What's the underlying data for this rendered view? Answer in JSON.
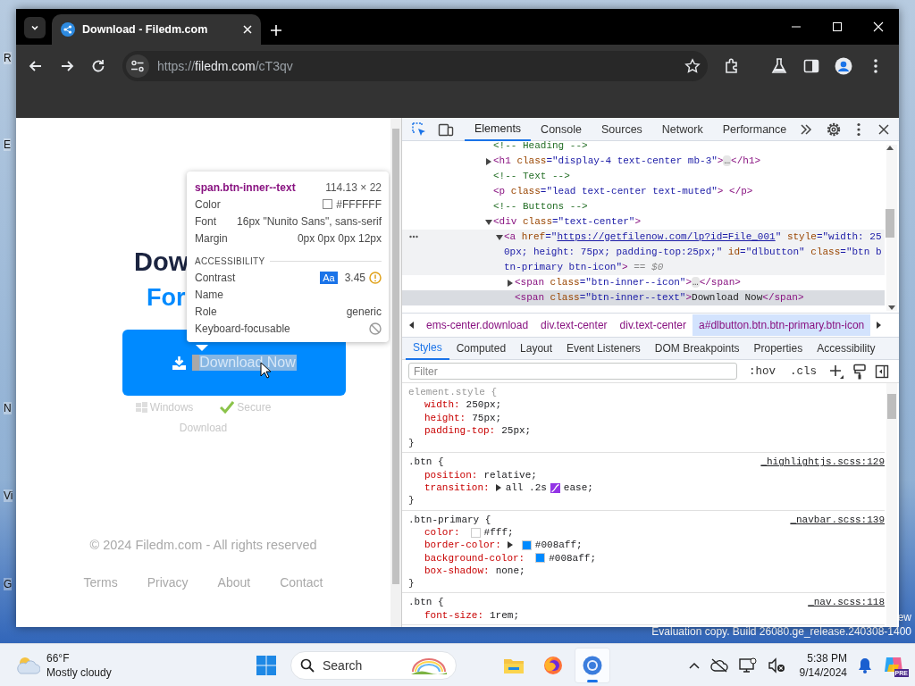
{
  "desktop": {
    "icon_labels": [
      "R",
      "E",
      "N",
      "Vi",
      "G"
    ],
    "notice_lines": [
      "ew",
      "Evaluation copy. Build 26080.ge_release.240308-1400"
    ]
  },
  "browser": {
    "tab": {
      "title": "Download - Filedm.com",
      "selected": true
    },
    "url": {
      "scheme": "https://",
      "host": "filedm.com",
      "path": "/cT3qv"
    }
  },
  "page": {
    "heading": [
      "Dow",
      "For"
    ],
    "button": {
      "label": "Download Now",
      "inspected": true
    },
    "features": [
      {
        "kind": "os",
        "label": "Windows"
      },
      {
        "kind": "check",
        "label": "Secure"
      }
    ],
    "caption": "Download",
    "copyright": "© 2024 Filedm.com - All rights reserved",
    "links": [
      "Terms",
      "Privacy",
      "About",
      "Contact"
    ]
  },
  "tooltip": {
    "selector": "span.btn-inner--text",
    "size": "114.13 × 22",
    "rows": [
      {
        "label": "Color",
        "value": "#FFFFFF",
        "color": "#ffffff"
      },
      {
        "label": "Font",
        "value": "16px \"Nunito Sans\", sans-serif"
      },
      {
        "label": "Margin",
        "value": "0px 0px 0px 12px"
      }
    ],
    "section": "ACCESSIBILITY",
    "a11y": [
      {
        "label": "Contrast",
        "kind": "contrast",
        "badge": "Aa",
        "value": "3.45"
      },
      {
        "label": "Name",
        "kind": "text"
      },
      {
        "label": "Role",
        "kind": "text",
        "value": "generic"
      },
      {
        "label": "Keyboard-focusable",
        "kind": "blocked"
      }
    ]
  },
  "devtools": {
    "tabs": [
      {
        "label": "Elements",
        "selected": true
      },
      {
        "label": "Console",
        "selected": false
      },
      {
        "label": "Sources",
        "selected": false
      },
      {
        "label": "Network",
        "selected": false
      },
      {
        "label": "Performance",
        "selected": false
      }
    ],
    "dom": [
      {
        "selected": false,
        "hovered": false,
        "parts": [
          {
            "kind": "comment",
            "text": "<!-- Heading -->"
          }
        ]
      },
      {
        "selected": false,
        "hovered": false,
        "expanded": false,
        "parts": [
          {
            "kind": "tag",
            "text": "<h1"
          },
          {
            "kind": "attr",
            "text": " class"
          },
          {
            "kind": "value",
            "text": "=\"display-4 text-center mb-3\""
          },
          {
            "kind": "tag",
            "text": ">"
          },
          {
            "kind": "ellipsis",
            "text": "…"
          },
          {
            "kind": "tag",
            "text": "</h1>"
          }
        ]
      },
      {
        "selected": false,
        "hovered": false,
        "parts": [
          {
            "kind": "comment",
            "text": "<!-- Text -->"
          }
        ]
      },
      {
        "selected": false,
        "hovered": false,
        "parts": [
          {
            "kind": "tag",
            "text": "<p"
          },
          {
            "kind": "attr",
            "text": " class"
          },
          {
            "kind": "value",
            "text": "=\"lead text-center text-muted\""
          },
          {
            "kind": "tag",
            "text": "> </p>"
          }
        ]
      },
      {
        "selected": false,
        "hovered": false,
        "parts": [
          {
            "kind": "comment",
            "text": "<!-- Buttons -->"
          }
        ]
      },
      {
        "selected": false,
        "hovered": false,
        "expanded": true,
        "parts": [
          {
            "kind": "tag",
            "text": "<div"
          },
          {
            "kind": "attr",
            "text": " class"
          },
          {
            "kind": "value",
            "text": "=\"text-center\""
          },
          {
            "kind": "tag",
            "text": ">"
          }
        ],
        "children": [
          {
            "selected": true,
            "hovered": false,
            "expanded": true,
            "parts": [
              {
                "kind": "tag",
                "text": "<a"
              },
              {
                "kind": "attr",
                "text": " href"
              },
              {
                "kind": "value",
                "text": "=\""
              },
              {
                "kind": "link",
                "text": "https://getfilenow.com/lp?id=File_001"
              },
              {
                "kind": "value",
                "text": "\""
              },
              {
                "kind": "attr",
                "text": " style"
              },
              {
                "kind": "value",
                "text": "=\"width: 250px; height: 75px; padding-top:25px;\""
              },
              {
                "kind": "attr",
                "text": " id"
              },
              {
                "kind": "value",
                "text": "=\"dlbutton\""
              },
              {
                "kind": "attr",
                "text": " class"
              },
              {
                "kind": "value",
                "text": "=\"btn btn-primary btn-icon\""
              },
              {
                "kind": "tag",
                "text": ">"
              },
              {
                "kind": "ref",
                "text": " == $0"
              }
            ],
            "children": [
              {
                "selected": false,
                "hovered": false,
                "expanded": false,
                "parts": [
                  {
                    "kind": "tag",
                    "text": "<span"
                  },
                  {
                    "kind": "attr",
                    "text": " class"
                  },
                  {
                    "kind": "value",
                    "text": "=\"btn-inner--icon\""
                  },
                  {
                    "kind": "tag",
                    "text": ">"
                  },
                  {
                    "kind": "ellipsis",
                    "text": "…"
                  },
                  {
                    "kind": "tag",
                    "text": "</span>"
                  }
                ]
              },
              {
                "selected": false,
                "hovered": true,
                "parts": [
                  {
                    "kind": "tag",
                    "text": "<span"
                  },
                  {
                    "kind": "attr",
                    "text": " class"
                  },
                  {
                    "kind": "value",
                    "text": "=\"btn-inner--text\""
                  },
                  {
                    "kind": "tag",
                    "text": ">"
                  },
                  {
                    "kind": "text",
                    "text": "Download Now"
                  },
                  {
                    "kind": "tag",
                    "text": "</span>"
                  }
                ]
              }
            ]
          }
        ]
      }
    ],
    "breadcrumbs": [
      {
        "label": "ems-center.download",
        "selected": false
      },
      {
        "label": "div.text-center",
        "selected": false
      },
      {
        "label": "div.text-center",
        "selected": false
      },
      {
        "label": "a#dlbutton.btn.btn-primary.btn-icon",
        "selected": true
      }
    ],
    "style_tabs": [
      {
        "label": "Styles",
        "selected": true
      },
      {
        "label": "Computed",
        "selected": false
      },
      {
        "label": "Layout",
        "selected": false
      },
      {
        "label": "Event Listeners",
        "selected": false
      },
      {
        "label": "DOM Breakpoints",
        "selected": false
      },
      {
        "label": "Properties",
        "selected": false
      },
      {
        "label": "Accessibility",
        "selected": false
      }
    ],
    "filter": {
      "placeholder": "Filter"
    },
    "filter_tools": [
      ":hov",
      ".cls"
    ],
    "rules": [
      {
        "selector": "element.style {",
        "inline": true,
        "close": "}",
        "declarations": [
          {
            "property": "width:",
            "segments": [
              {
                "kind": "text",
                "text": "250px;"
              }
            ]
          },
          {
            "property": "height:",
            "segments": [
              {
                "kind": "text",
                "text": "75px;"
              }
            ]
          },
          {
            "property": "padding-top:",
            "segments": [
              {
                "kind": "text",
                "text": "25px;"
              }
            ]
          }
        ]
      },
      {
        "selector": ".btn {",
        "inline": false,
        "source": "_highlightjs.scss:129",
        "close": "}",
        "declarations": [
          {
            "property": "position:",
            "segments": [
              {
                "kind": "text",
                "text": "relative;"
              }
            ]
          },
          {
            "property": "transition:",
            "expandable": true,
            "segments": [
              {
                "kind": "text",
                "text": "all .2s"
              },
              {
                "kind": "easing"
              },
              {
                "kind": "text",
                "text": "ease;"
              }
            ]
          }
        ]
      },
      {
        "selector": ".btn-primary {",
        "inline": false,
        "source": "_navbar.scss:139",
        "close": "}",
        "declarations": [
          {
            "property": "color:",
            "segments": [
              {
                "kind": "color",
                "color": "#ffffff"
              },
              {
                "kind": "text",
                "text": "#fff;"
              }
            ]
          },
          {
            "property": "border-color:",
            "expandable": true,
            "segments": [
              {
                "kind": "color",
                "color": "#008aff"
              },
              {
                "kind": "text",
                "text": "#008aff;"
              }
            ]
          },
          {
            "property": "background-color:",
            "segments": [
              {
                "kind": "color",
                "color": "#008aff"
              },
              {
                "kind": "text",
                "text": "#008aff;"
              }
            ]
          },
          {
            "property": "box-shadow:",
            "segments": [
              {
                "kind": "text",
                "text": "none;"
              }
            ]
          }
        ]
      },
      {
        "selector": ".btn {",
        "inline": false,
        "source": "_nav.scss:118",
        "declarations": [
          {
            "property": "font-size:",
            "segments": [
              {
                "kind": "text",
                "text": "1rem;"
              }
            ]
          }
        ]
      }
    ]
  },
  "taskbar": {
    "weather": {
      "temp": "66°F",
      "condition": "Mostly cloudy"
    },
    "search": {
      "placeholder": "Search"
    },
    "apps": [
      {
        "kind": "explorer",
        "active": false
      },
      {
        "kind": "firefox",
        "active": false
      },
      {
        "kind": "chrome",
        "active": true
      }
    ],
    "clock": {
      "time": "5:38 PM",
      "date": "9/14/2024"
    },
    "copilot_badge": "PRE"
  }
}
